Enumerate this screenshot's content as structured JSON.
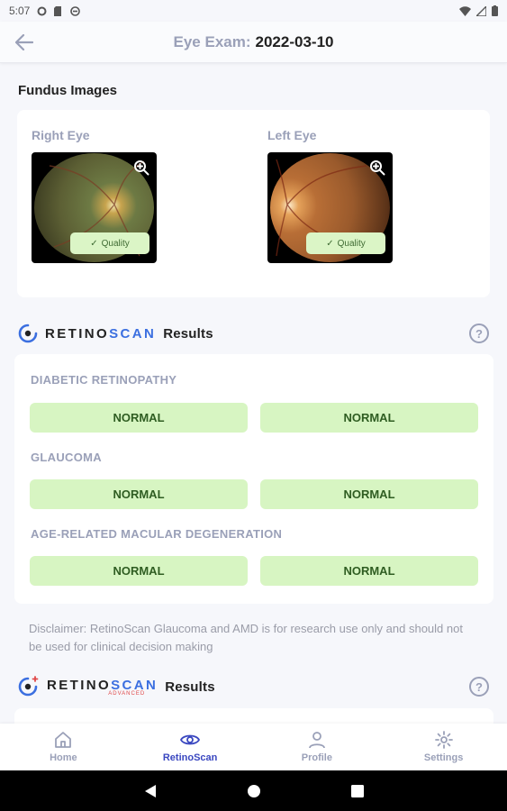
{
  "status_bar": {
    "time": "5:07"
  },
  "header": {
    "title_prefix": "Eye Exam:",
    "title_date": "2022-03-10"
  },
  "fundus": {
    "section_title": "Fundus Images",
    "right": {
      "label": "Right Eye",
      "quality": "Quality"
    },
    "left": {
      "label": "Left Eye",
      "quality": "Quality"
    }
  },
  "results": {
    "brand_retino": "RETINO",
    "brand_scan": "SCAN",
    "brand_results": "Results",
    "help": "?",
    "conditions": [
      {
        "label": "DIABETIC RETINOPATHY",
        "right": "NORMAL",
        "left": "NORMAL"
      },
      {
        "label": "GLAUCOMA",
        "right": "NORMAL",
        "left": "NORMAL"
      },
      {
        "label": "AGE-RELATED MACULAR DEGENERATION",
        "right": "NORMAL",
        "left": "NORMAL"
      }
    ],
    "disclaimer": "Disclaimer: RetinoScan Glaucoma and AMD is for research use only and should not be used for clinical decision making"
  },
  "advanced": {
    "brand_retino": "RETINO",
    "brand_scan": "SCAN",
    "brand_sub": "ADVANCED",
    "brand_results": "Results",
    "help": "?"
  },
  "bottom_nav": [
    {
      "label": "Home",
      "icon": "home-icon"
    },
    {
      "label": "RetinoScan",
      "icon": "eye-icon"
    },
    {
      "label": "Profile",
      "icon": "person-icon"
    },
    {
      "label": "Settings",
      "icon": "gear-icon"
    }
  ],
  "colors": {
    "accent": "#3a47c0",
    "brand_blue": "#3b6fe0",
    "normal_bg": "#d7f5c2",
    "normal_text": "#2f5d22"
  }
}
